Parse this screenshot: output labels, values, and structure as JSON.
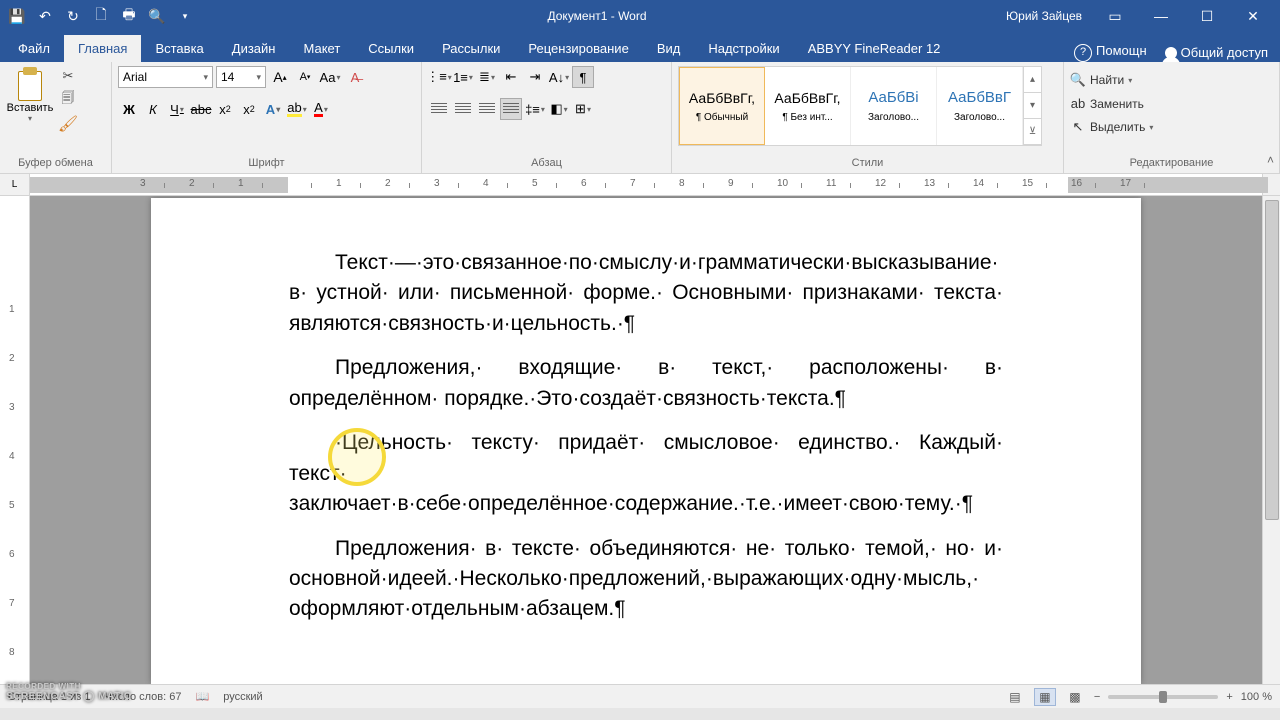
{
  "title": "Документ1 - Word",
  "user": "Юрий Зайцев",
  "tabs": {
    "file": "Файл",
    "home": "Главная",
    "insert": "Вставка",
    "design": "Дизайн",
    "layout": "Макет",
    "references": "Ссылки",
    "mailings": "Рассылки",
    "review": "Рецензирование",
    "view": "Вид",
    "addins": "Надстройки",
    "abbyy": "ABBYY FineReader 12",
    "tell_me": "Помощн",
    "share": "Общий доступ"
  },
  "ribbon": {
    "clipboard": {
      "paste": "Вставить",
      "label": "Буфер обмена"
    },
    "font": {
      "name": "Arial",
      "size": "14",
      "label": "Шрифт"
    },
    "paragraph": {
      "label": "Абзац"
    },
    "styles": {
      "label": "Стили",
      "items": [
        {
          "sample": "АаБбВвГг,",
          "name": "¶ Обычный",
          "sel": true
        },
        {
          "sample": "АаБбВвГг,",
          "name": "¶ Без инт..."
        },
        {
          "sample": "АаБбВі",
          "name": "Заголово...",
          "heading": true
        },
        {
          "sample": "АаБбВвГ",
          "name": "Заголово...",
          "heading": true
        }
      ]
    },
    "editing": {
      "find": "Найти",
      "replace": "Заменить",
      "select": "Выделить",
      "label": "Редактирование"
    }
  },
  "ruler": {
    "corner": "L",
    "dark_left_w": 140,
    "dark_right_start": 1060,
    "ticks": [
      "3",
      "2",
      "1",
      "",
      "1",
      "2",
      "3",
      "4",
      "5",
      "6",
      "7",
      "8",
      "9",
      "10",
      "11",
      "12",
      "13",
      "14",
      "15",
      "16",
      "17"
    ]
  },
  "vruler": [
    "",
    "",
    "1",
    "2",
    "3",
    "4",
    "5",
    "6",
    "7",
    "8"
  ],
  "document": {
    "p1": "Текст·—·это·связанное·по·смыслу·и·грамматически·высказывание· в· устной· или· письменной· форме.· Основными· признаками· текста· являются·связность·и·цельность.·¶",
    "p2": "Предложения,· входящие· в· текст,· расположены· в· определённом· порядке.·Это·создаёт·связность·текста.¶",
    "p3": "·Цельность· тексту· придаёт· смысловое· единство.· Каждый· текст· заключает·в·себе·определённое·содержание.·т.е.·имеет·свою·тему.·¶",
    "p4": "Предложения· в· тексте· объединяются· не· только· темой,· но· и· основной·идеей.·Несколько·предложений,·выражающих·одну·мысль,· оформляют·отдельным·абзацем.¶"
  },
  "status": {
    "page": "Страница 1 из 1",
    "words": "Число слов: 67",
    "lang": "русский",
    "zoom": "100 %"
  },
  "watermark": {
    "small": "RECORDED WITH",
    "brand": "SCREENCAST ◯ MATIC"
  }
}
